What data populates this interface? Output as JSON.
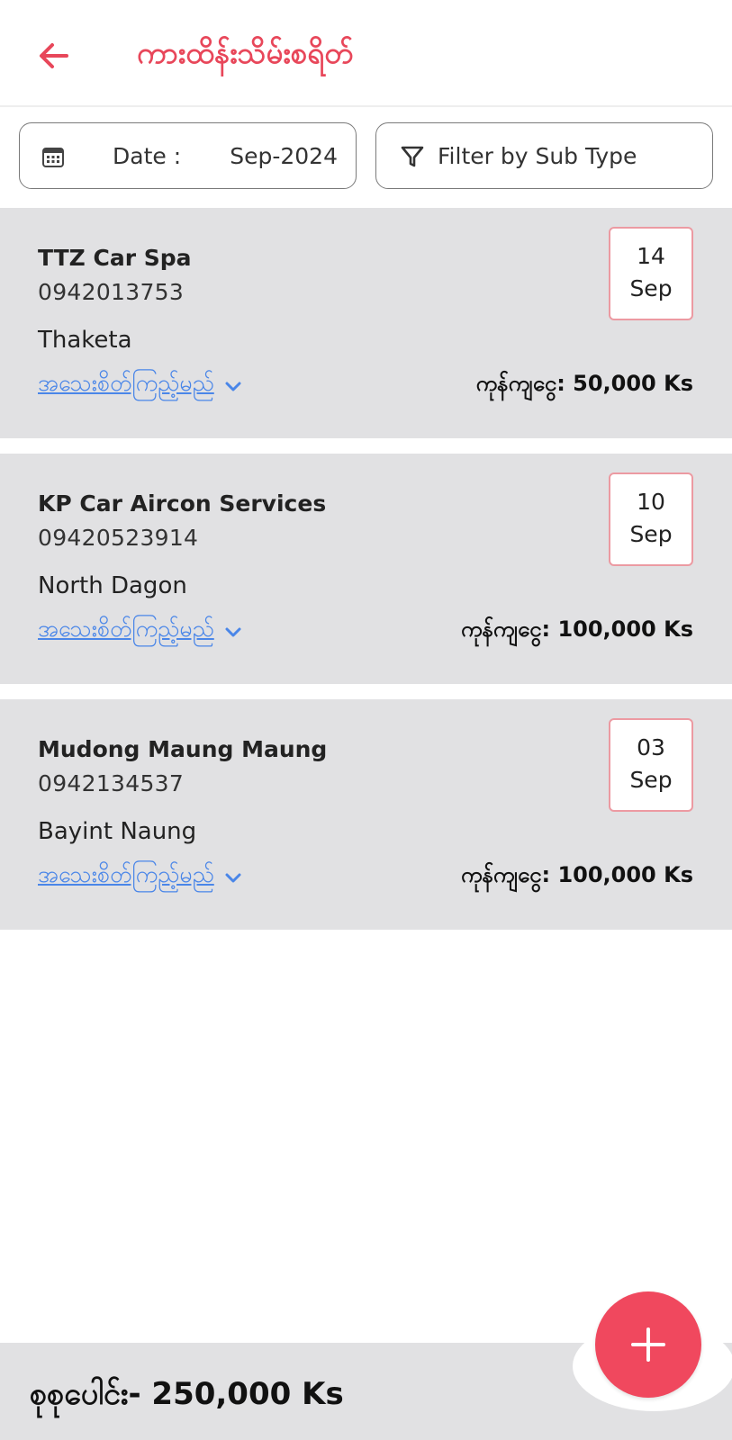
{
  "header": {
    "title": "ကားထိန်းသိမ်းစရိတ်",
    "back_icon": "arrow-left-icon"
  },
  "filters": {
    "date_label": "Date :",
    "date_value": "Sep-2024",
    "date_icon": "calendar-icon",
    "subtype_label": "Filter by Sub Type",
    "subtype_icon": "funnel-icon"
  },
  "records": [
    {
      "name": "TTZ Car Spa",
      "phone": "0942013753",
      "township": "Thaketa",
      "detail_label": "အသေးစိတ်ကြည့်မည်",
      "amount": "ကုန်ကျငွေ: 50,000 Ks",
      "day": "14",
      "month": "Sep"
    },
    {
      "name": "KP Car Aircon Services",
      "phone": "09420523914",
      "township": "North Dagon",
      "detail_label": "အသေးစိတ်ကြည့်မည်",
      "amount": "ကုန်ကျငွေ: 100,000 Ks",
      "day": "10",
      "month": "Sep"
    },
    {
      "name": "Mudong Maung Maung",
      "phone": "0942134537",
      "township": "Bayint Naung",
      "detail_label": "အသေးစိတ်ကြည့်မည်",
      "amount": "ကုန်ကျငွေ: 100,000 Ks",
      "day": "03",
      "month": "Sep"
    }
  ],
  "footer": {
    "total": "စုစုပေါင်း- 250,000 Ks",
    "fab_icon": "plus-icon"
  },
  "colors": {
    "accent": "#e8475a",
    "fab": "#f0485e",
    "card_background": "#e1e1e3",
    "link": "#4a86e8",
    "badge_border": "#ec9aa2"
  }
}
